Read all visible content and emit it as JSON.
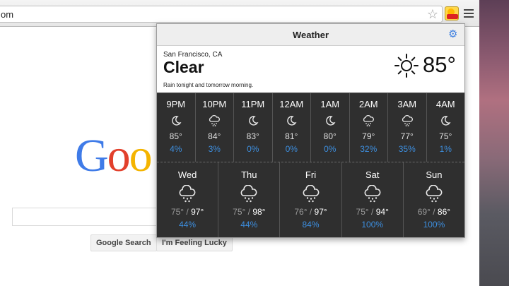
{
  "browser": {
    "url_fragment": "om",
    "extension_name": "Weather"
  },
  "google": {
    "logo_visible": "Goo",
    "search_button": "Google Search",
    "lucky_button": "I'm Feeling Lucky"
  },
  "weather": {
    "title": "Weather",
    "location": "San Francisco, CA",
    "condition": "Clear",
    "summary": "Rain tonight and tomorrow morning.",
    "current_temp": "85°",
    "current_icon": "sun-icon",
    "hourly": [
      {
        "time": "9PM",
        "icon": "moon-icon",
        "temp": "85°",
        "precip": "4%"
      },
      {
        "time": "10PM",
        "icon": "rain-cloud-icon",
        "temp": "84°",
        "precip": "3%"
      },
      {
        "time": "11PM",
        "icon": "moon-icon",
        "temp": "83°",
        "precip": "0%"
      },
      {
        "time": "12AM",
        "icon": "moon-icon",
        "temp": "81°",
        "precip": "0%"
      },
      {
        "time": "1AM",
        "icon": "moon-icon",
        "temp": "80°",
        "precip": "0%"
      },
      {
        "time": "2AM",
        "icon": "rain-cloud-icon",
        "temp": "79°",
        "precip": "32%"
      },
      {
        "time": "3AM",
        "icon": "rain-cloud-icon",
        "temp": "77°",
        "precip": "35%"
      },
      {
        "time": "4AM",
        "icon": "moon-icon",
        "temp": "75°",
        "precip": "1%"
      }
    ],
    "daily": [
      {
        "day": "Wed",
        "icon": "rain-cloud-icon",
        "low": "75°",
        "high": "97°",
        "precip": "44%"
      },
      {
        "day": "Thu",
        "icon": "rain-cloud-icon",
        "low": "75°",
        "high": "98°",
        "precip": "44%"
      },
      {
        "day": "Fri",
        "icon": "rain-cloud-icon",
        "low": "76°",
        "high": "97°",
        "precip": "84%"
      },
      {
        "day": "Sat",
        "icon": "rain-cloud-icon",
        "low": "75°",
        "high": "94°",
        "precip": "100%"
      },
      {
        "day": "Sun",
        "icon": "rain-cloud-icon",
        "low": "69°",
        "high": "86°",
        "precip": "100%"
      }
    ]
  },
  "colors": {
    "precip_blue": "#3d8fe0",
    "panel_dark": "#2f2f2f",
    "gear_blue": "#3d7fe0"
  }
}
